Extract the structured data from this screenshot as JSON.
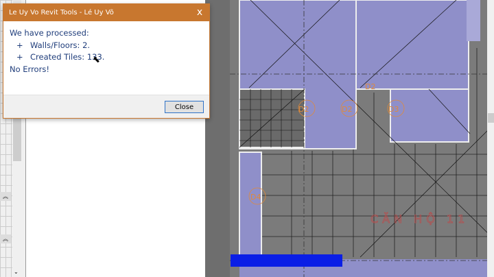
{
  "dialog": {
    "title": "Le Uy Vo Revit Tools - Lé Uy Võ",
    "close_icon": "x",
    "lines": {
      "intro": "We have processed:",
      "bullet": "+",
      "walls": "Walls/Floors: 2.",
      "tiles": "Created Tiles: 133.",
      "errors": "No Errors!"
    },
    "close_button": "Close"
  },
  "plan": {
    "door_tags": [
      "D2",
      "D2",
      "D2",
      "D3",
      "D4"
    ],
    "room_label": "CĂN HỘ 11",
    "colors": {
      "room_fill": "#8f8fc9",
      "tile_fill": "#7b7b7b",
      "tag": "#e08a3a",
      "selected": "#0a1ee6"
    }
  },
  "properties": {
    "collapse_icon": "«"
  }
}
